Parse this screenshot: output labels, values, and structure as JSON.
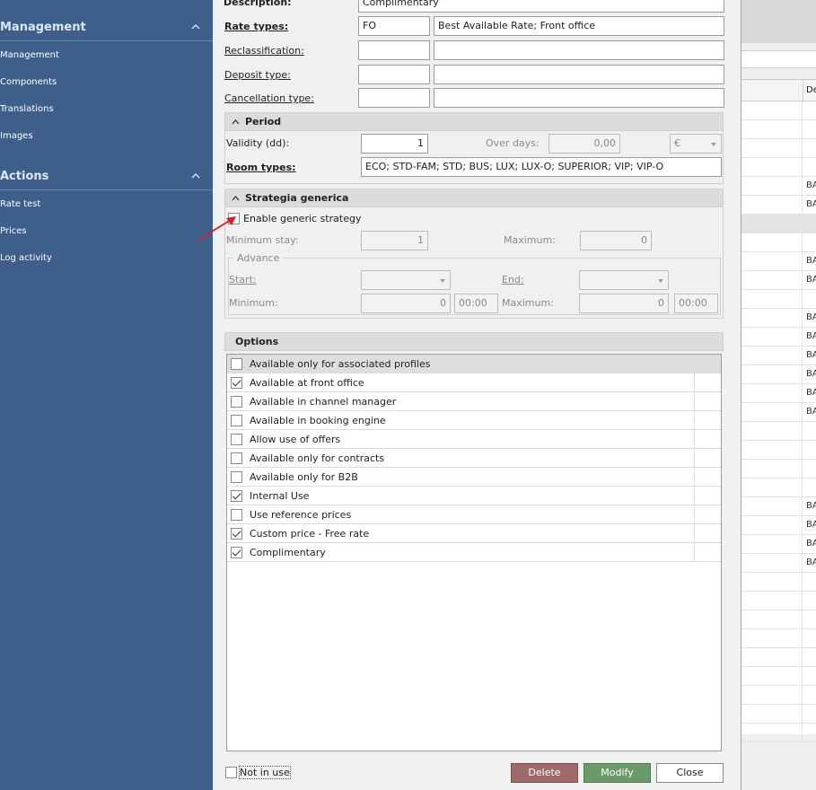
{
  "sidebar": {
    "sections": [
      {
        "title": "Management",
        "items": [
          "Management",
          "Components",
          "Translations",
          "Images"
        ]
      },
      {
        "title": "Actions",
        "items": [
          "Rate test",
          "Prices",
          "Log activity"
        ]
      }
    ]
  },
  "background": {
    "header_partial": "De",
    "rows": [
      {
        "text": "",
        "group": false
      },
      {
        "text": "",
        "group": false
      },
      {
        "text": "",
        "group": false
      },
      {
        "text": "",
        "group": false
      },
      {
        "text": "BA",
        "group": false
      },
      {
        "text": "BA",
        "group": false
      },
      {
        "text": "",
        "group": true
      },
      {
        "text": "",
        "group": false
      },
      {
        "text": "BA",
        "group": false
      },
      {
        "text": "BA",
        "group": false
      },
      {
        "text": "",
        "group": false
      },
      {
        "text": "BA",
        "group": false
      },
      {
        "text": "BA",
        "group": false
      },
      {
        "text": "BA",
        "group": false
      },
      {
        "text": "BA",
        "group": false
      },
      {
        "text": "BA",
        "group": false
      },
      {
        "text": "BA",
        "group": false
      },
      {
        "text": "",
        "group": false
      },
      {
        "text": "",
        "group": false
      },
      {
        "text": "",
        "group": false
      },
      {
        "text": "",
        "group": false
      },
      {
        "text": "BA",
        "group": false
      },
      {
        "text": "BA",
        "group": false
      },
      {
        "text": "BA",
        "group": false
      },
      {
        "text": "BA",
        "group": false
      },
      {
        "text": "",
        "group": false
      },
      {
        "text": "",
        "group": false
      },
      {
        "text": "",
        "group": false
      },
      {
        "text": "",
        "group": false
      },
      {
        "text": "",
        "group": false
      },
      {
        "text": "",
        "group": false
      },
      {
        "text": "",
        "group": false
      },
      {
        "text": "",
        "group": false
      },
      {
        "text": "",
        "group": false
      }
    ]
  },
  "form": {
    "description_label": "Description:",
    "description_value": "Complimentary",
    "rate_types_label": "Rate types:",
    "rate_types_code": "FO",
    "rate_types_desc": "Best Available Rate; Front office",
    "reclassification_label": "Reclassification:",
    "reclassification_code": "",
    "reclassification_desc": "",
    "deposit_type_label": "Deposit type:",
    "deposit_type_code": "",
    "deposit_type_desc": "",
    "cancellation_type_label": "Cancellation type:",
    "cancellation_type_code": "",
    "cancellation_type_desc": ""
  },
  "period": {
    "title": "Period",
    "validity_label": "Validity (dd):",
    "validity_value": "1",
    "over_days_label": "Over days:",
    "over_days_value": "0,00",
    "currency": "€",
    "room_types_label": "Room types:",
    "room_types_value": "ECO; STD-FAM; STD; BUS; LUX; LUX-O; SUPERIOR; VIP; VIP-O"
  },
  "strategy": {
    "title": "Strategia generica",
    "enable_label": "Enable generic strategy",
    "enable_checked": false,
    "min_stay_label": "Minimum stay:",
    "min_stay_value": "1",
    "maximum_label": "Maximum:",
    "maximum_value": "0",
    "advance_title": "Advance",
    "start_label": "Start:",
    "start_value": "",
    "end_label": "End:",
    "end_value": "",
    "adv_min_label": "Minimum:",
    "adv_min_value": "0",
    "adv_min_time": "00:00",
    "adv_max_label": "Maximum:",
    "adv_max_value": "0",
    "adv_max_time": "00:00"
  },
  "options": {
    "title": "Options",
    "items": [
      {
        "label": "Available only for associated profiles",
        "checked": false,
        "selected": true
      },
      {
        "label": "Available at front office",
        "checked": true,
        "selected": false
      },
      {
        "label": "Available in channel manager",
        "checked": false,
        "selected": false
      },
      {
        "label": "Available in booking engine",
        "checked": false,
        "selected": false
      },
      {
        "label": "Allow use of offers",
        "checked": false,
        "selected": false
      },
      {
        "label": "Available only for contracts",
        "checked": false,
        "selected": false
      },
      {
        "label": "Available only for B2B",
        "checked": false,
        "selected": false
      },
      {
        "label": "Internal Use",
        "checked": true,
        "selected": false
      },
      {
        "label": "Use reference prices",
        "checked": false,
        "selected": false
      },
      {
        "label": "Custom price - Free rate",
        "checked": true,
        "selected": false
      },
      {
        "label": "Complimentary",
        "checked": true,
        "selected": false
      }
    ]
  },
  "footer": {
    "not_in_use_label": "Not in use",
    "not_in_use_checked": false,
    "delete_label": "Delete",
    "modify_label": "Modify",
    "close_label": "Close"
  },
  "colors": {
    "sidebar_bg": "#3e5f8a",
    "delete_button": "#9e6a6a",
    "modify_button": "#6a9a6a",
    "annotation_arrow": "#d42020"
  }
}
